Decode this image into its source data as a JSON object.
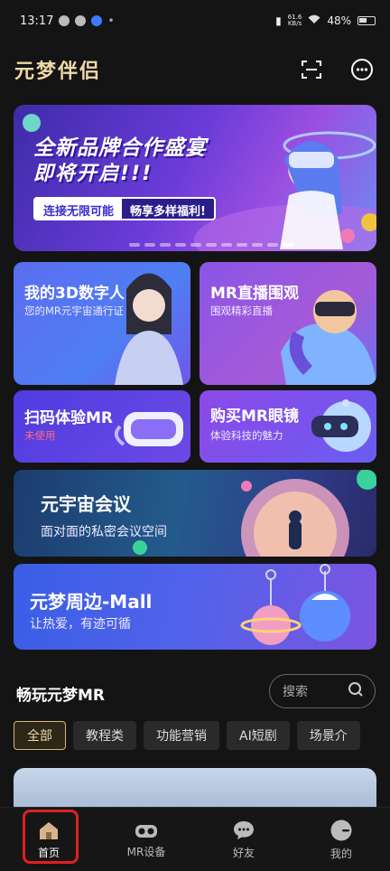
{
  "status_bar": {
    "time": "13:17",
    "net_speed": "61.6",
    "net_unit": "KB/s",
    "battery": "48%"
  },
  "header": {
    "title": "元梦伴侣",
    "scan_icon": "scan-icon",
    "message_icon": "chat-bubble-icon"
  },
  "banner": {
    "line1": "全新品牌合作盛宴",
    "line2": "即将开启!!!",
    "tag_a": "连接无限可能",
    "tag_b": "畅享多样福利!",
    "page_count": 11,
    "active_page": 10
  },
  "cards": {
    "digital_human": {
      "title": "我的3D数字人",
      "subtitle": "您的MR元宇宙通行证"
    },
    "live": {
      "title": "MR直播围观",
      "subtitle": "围观精彩直播"
    },
    "scan": {
      "title": "扫码体验MR",
      "status": "未使用"
    },
    "buy": {
      "title": "购买MR眼镜",
      "subtitle": "体验科技的魅力"
    },
    "meeting": {
      "title": "元宇宙会议",
      "subtitle": "面对面的私密会议空间"
    },
    "mall": {
      "title": "元梦周边-Mall",
      "subtitle": "让热爱，有迹可循"
    }
  },
  "section": {
    "title": "畅玩元梦MR",
    "search_label": "搜索"
  },
  "categories": [
    "全部",
    "教程类",
    "功能营销",
    "AI短剧",
    "场景介"
  ],
  "active_category": "全部",
  "nav": [
    {
      "label": "首页",
      "icon": "home-icon"
    },
    {
      "label": "MR设备",
      "icon": "vr-headset-icon"
    },
    {
      "label": "好友",
      "icon": "chat-icon"
    },
    {
      "label": "我的",
      "icon": "profile-icon"
    }
  ],
  "colors": {
    "brand_gold": "#f1d8a6",
    "background": "#141414",
    "highlight_red": "#e02020"
  }
}
